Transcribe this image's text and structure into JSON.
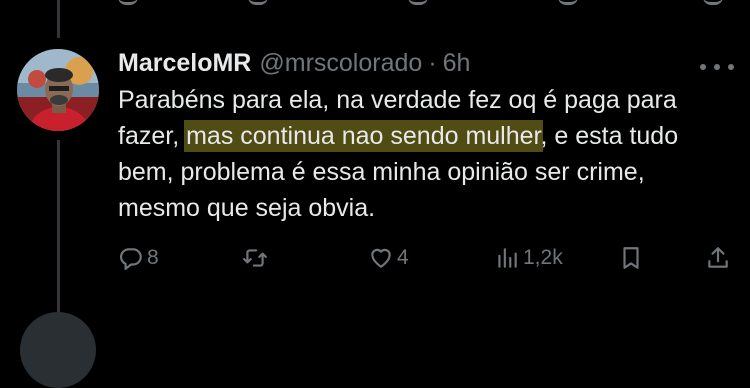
{
  "tweet": {
    "author": {
      "display_name": "MarceloMR",
      "handle": "@mrscolorado",
      "separator": "·",
      "time": "6h"
    },
    "text": {
      "part1": "Parabéns para ela, na verdade fez oq é paga para fazer, ",
      "highlighted": "mas continua nao sendo mulher",
      "part2": ", e esta tudo bem, problema é essa minha opinião ser crime, mesmo que seja obvia."
    },
    "actions": {
      "reply_count": "8",
      "retweet_count": "",
      "like_count": "4",
      "views_count": "1,2k"
    }
  },
  "colors": {
    "background": "#000000",
    "text_primary": "#e7e9ea",
    "text_secondary": "#71767b",
    "highlight": "#a89e2a"
  },
  "icons": {
    "reply": "reply-icon",
    "retweet": "retweet-icon",
    "like": "heart-icon",
    "views": "views-icon",
    "bookmark": "bookmark-icon",
    "share": "share-icon",
    "more": "more-icon"
  }
}
